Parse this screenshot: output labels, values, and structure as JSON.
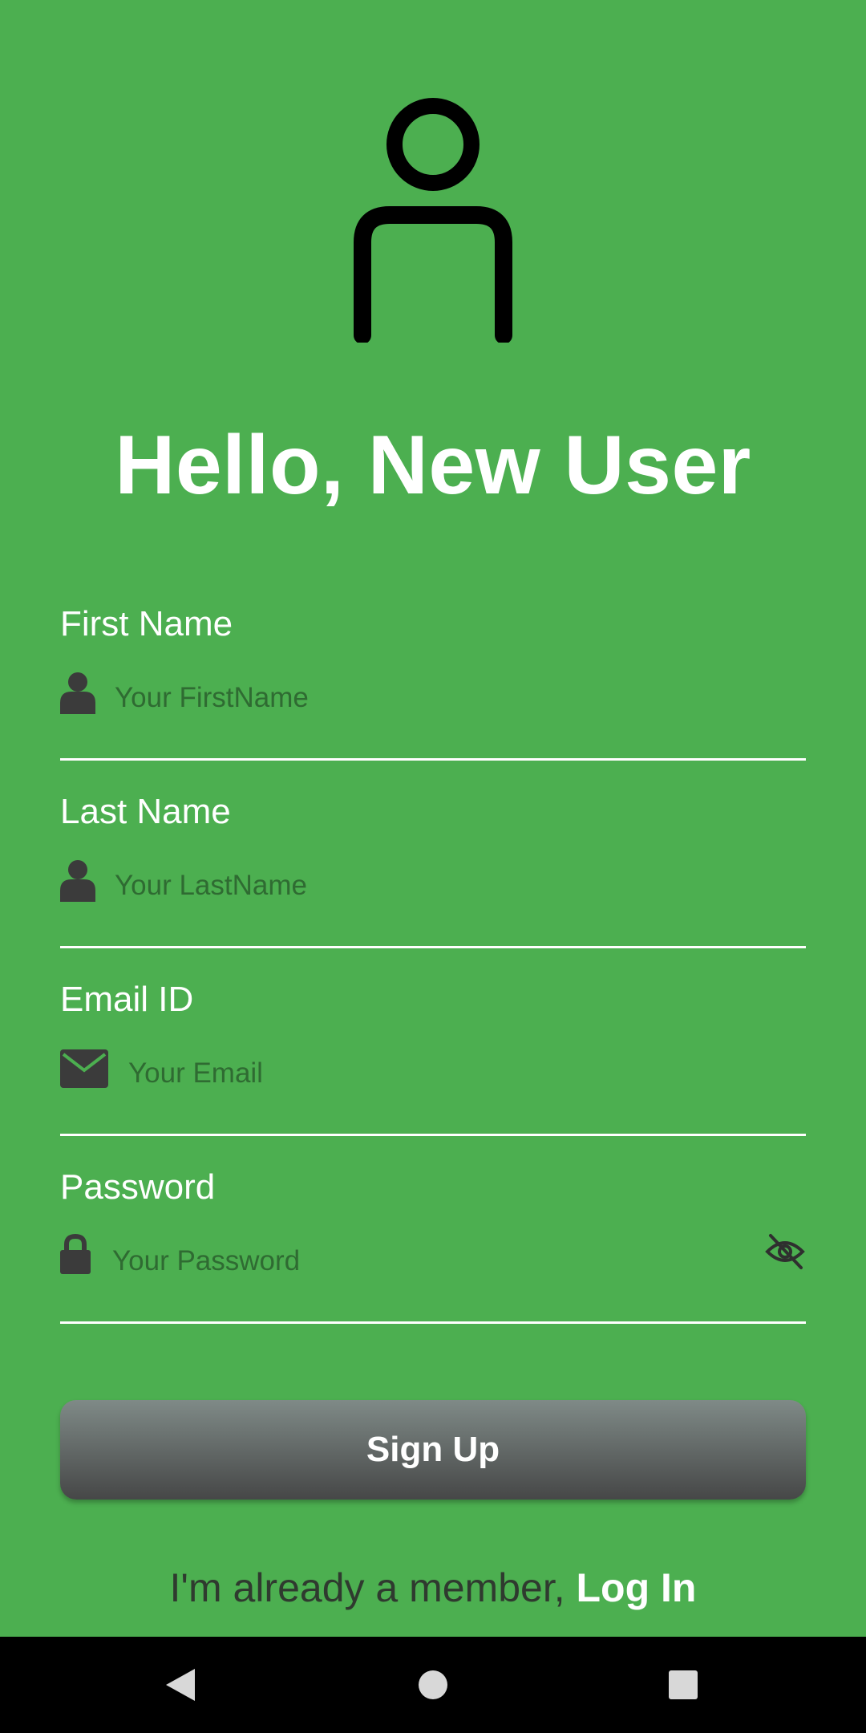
{
  "header": {
    "title": "Hello, New User"
  },
  "form": {
    "first_name": {
      "label": "First Name",
      "placeholder": "Your FirstName"
    },
    "last_name": {
      "label": "Last Name",
      "placeholder": "Your LastName"
    },
    "email": {
      "label": "Email ID",
      "placeholder": "Your Email"
    },
    "password": {
      "label": "Password",
      "placeholder": "Your Password"
    }
  },
  "actions": {
    "signup_label": "Sign Up",
    "login_prompt": "I'm already a member, ",
    "login_link": "Log In"
  },
  "icons": {
    "avatar": "person-outline-icon",
    "first_name": "person-icon",
    "last_name": "person-icon",
    "email": "envelope-icon",
    "password": "lock-icon",
    "toggle": "eye-off-icon"
  },
  "colors": {
    "background": "#4CAF50",
    "text": "#FFFFFF",
    "button_gradient_top": "#7F8A87",
    "button_gradient_bottom": "#464747",
    "navbar": "#000000"
  }
}
